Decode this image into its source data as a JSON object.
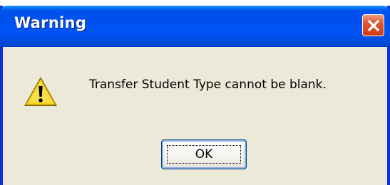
{
  "dialog": {
    "title": "Warning",
    "message": "Transfer Student Type cannot be blank.",
    "ok_label": "OK",
    "icon": "warning-icon",
    "close_icon": "close-icon"
  },
  "colors": {
    "titlebar": "#0053ee",
    "frame": "#0831d9",
    "client_bg": "#ece9d8",
    "close_button": "#e0562e",
    "warning_yellow": "#f7d41e"
  }
}
